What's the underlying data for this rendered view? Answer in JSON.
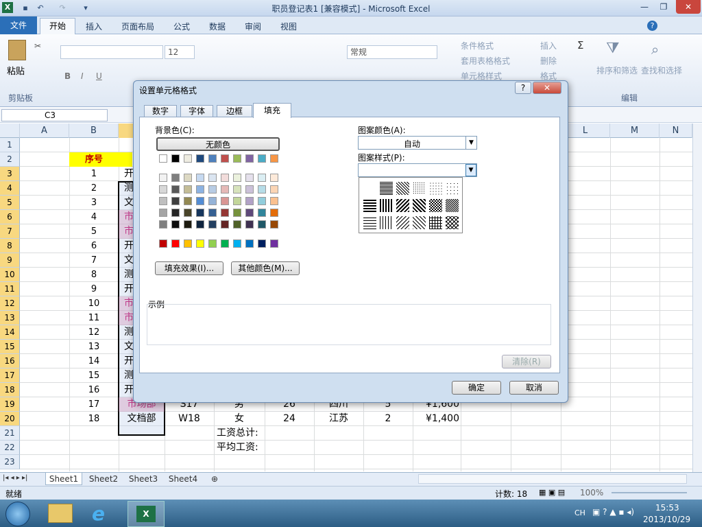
{
  "window": {
    "title": "职员登记表1  [兼容模式] - Microsoft Excel"
  },
  "ribbon": {
    "tabs": [
      "文件",
      "开始",
      "插入",
      "页面布局",
      "公式",
      "数据",
      "审阅",
      "视图"
    ],
    "paste": "粘贴",
    "font_size": "12",
    "number_format": "常规",
    "conditional_format": "条件格式",
    "table_format": "套用表格格式",
    "cell_styles": "单元格样式",
    "insert": "插入",
    "delete": "删除",
    "format": "格式",
    "sort_filter": "排序和筛选",
    "find_select": "查找和选择",
    "group_clipboard": "剪贴板",
    "group_edit": "编辑"
  },
  "formula_bar": {
    "name_box": "C3"
  },
  "sheet": {
    "columns": [
      "A",
      "B",
      "C",
      "D",
      "E",
      "F",
      "G",
      "H",
      "I",
      "J",
      "K",
      "L",
      "M",
      "N"
    ],
    "rows": [
      "1",
      "2",
      "3",
      "4",
      "5",
      "6",
      "7",
      "8",
      "9",
      "10",
      "11",
      "12",
      "13",
      "14",
      "15",
      "16",
      "17",
      "18",
      "19",
      "20",
      "21",
      "22",
      "23"
    ],
    "header_label": "序号",
    "seq": [
      "1",
      "2",
      "3",
      "4",
      "5",
      "6",
      "7",
      "8",
      "9",
      "10",
      "11",
      "12",
      "13",
      "14",
      "15",
      "16",
      "17",
      "18"
    ],
    "dept_first": [
      "开",
      "测",
      "文",
      "市",
      "市",
      "开",
      "文",
      "测",
      "开",
      "市",
      "市",
      "测",
      "文",
      "开",
      "测",
      "开"
    ],
    "row19": {
      "dept": "市场部",
      "id": "S17",
      "sex": "男",
      "age": "26",
      "prov": "四川",
      "years": "5",
      "salary": "¥1,600"
    },
    "row20": {
      "dept": "文档部",
      "id": "W18",
      "sex": "女",
      "age": "24",
      "prov": "江苏",
      "years": "2",
      "salary": "¥1,400"
    },
    "total_label": "工资总计:",
    "avg_label": "平均工资:"
  },
  "sheet_tabs": [
    "Sheet1",
    "Sheet2",
    "Sheet3",
    "Sheet4"
  ],
  "status": {
    "ready": "就绪",
    "count": "计数: 18",
    "zoom": "100%"
  },
  "taskbar": {
    "lang": "CH",
    "time": "15:53",
    "date": "2013/10/29"
  },
  "dialog": {
    "title": "设置单元格格式",
    "tabs": [
      "数字",
      "字体",
      "边框",
      "填充"
    ],
    "bg_color_label": "背景色(C):",
    "no_color": "无颜色",
    "fill_effects": "填充效果(I)...",
    "more_colors": "其他颜色(M)...",
    "pattern_color_label": "图案颜色(A):",
    "pattern_color_value": "自动",
    "pattern_style_label": "图案样式(P):",
    "sample_label": "示例",
    "clear": "清除(R)",
    "ok": "确定",
    "cancel": "取消",
    "theme_row1": [
      "#ffffff",
      "#000000",
      "#eeece1",
      "#1f497d",
      "#4f81bd",
      "#c0504d",
      "#9bbb59",
      "#8064a2",
      "#4bacc6",
      "#f79646"
    ],
    "shades": [
      [
        "#f2f2f2",
        "#7f7f7f",
        "#ddd9c3",
        "#c6d9f0",
        "#dbe5f1",
        "#f2dcdb",
        "#ebf1dd",
        "#e5e0ec",
        "#dbeef3",
        "#fdeada"
      ],
      [
        "#d8d8d8",
        "#595959",
        "#c4bd97",
        "#8db3e2",
        "#b8cce4",
        "#e5b9b7",
        "#d7e3bc",
        "#ccc1d9",
        "#b7dde8",
        "#fbd5b5"
      ],
      [
        "#bfbfbf",
        "#3f3f3f",
        "#938953",
        "#548dd4",
        "#95b3d7",
        "#d99694",
        "#c3d69b",
        "#b2a2c7",
        "#92cddc",
        "#fac08f"
      ],
      [
        "#a5a5a5",
        "#262626",
        "#494429",
        "#17365d",
        "#366092",
        "#953734",
        "#76923c",
        "#5f497a",
        "#31859b",
        "#e36c09"
      ],
      [
        "#7f7f7f",
        "#0c0c0c",
        "#1d1b10",
        "#0f243e",
        "#244061",
        "#632423",
        "#4f6128",
        "#3f3151",
        "#205867",
        "#974806"
      ]
    ],
    "standard": [
      "#c00000",
      "#ff0000",
      "#ffc000",
      "#ffff00",
      "#92d050",
      "#00b050",
      "#00b0f0",
      "#0070c0",
      "#002060",
      "#7030a0"
    ]
  }
}
